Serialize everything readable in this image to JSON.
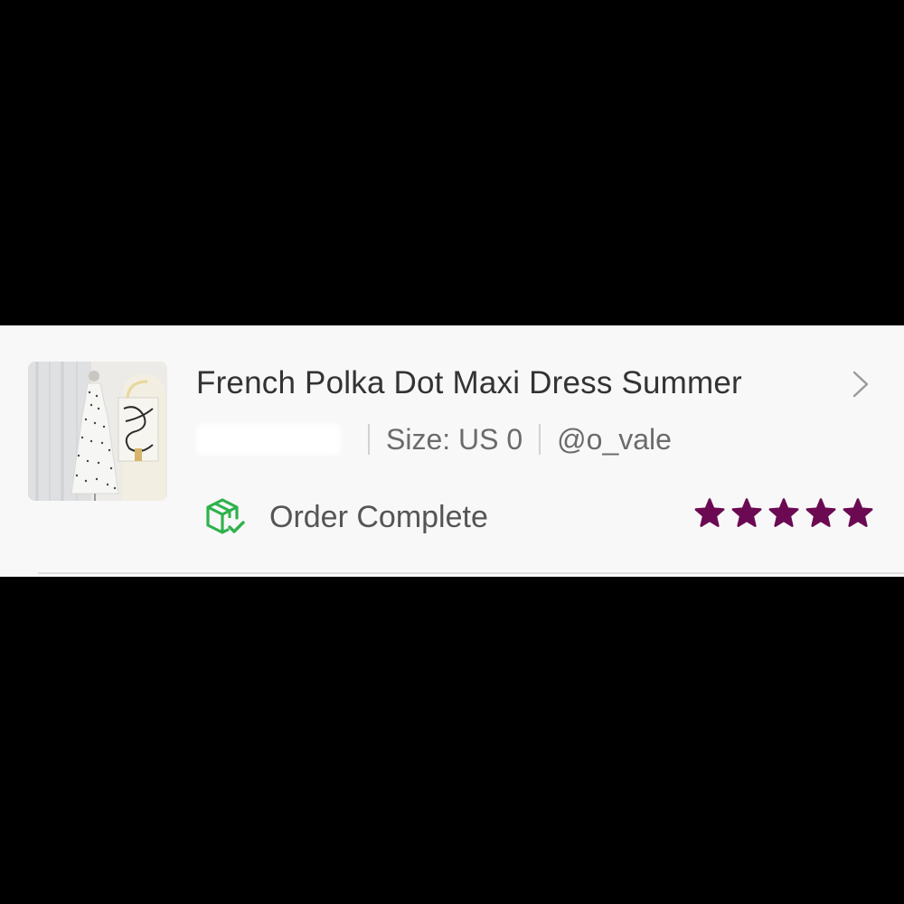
{
  "order": {
    "title": "French Polka Dot Maxi Dress Summer",
    "meta": {
      "size": "Size: US 0",
      "seller": "@o_vale"
    },
    "status": "Order Complete",
    "rating": 5,
    "rating_max": 5
  },
  "colors": {
    "star": "#6b0a52",
    "status_icon": "#2fb24c"
  },
  "icons": {
    "chevron": "chevron-right-icon",
    "status": "package-check-icon",
    "star": "star-icon"
  }
}
